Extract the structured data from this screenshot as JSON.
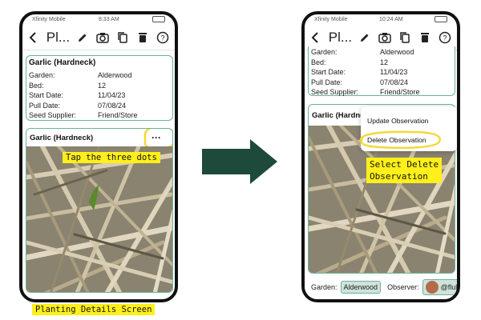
{
  "left_phone": {
    "status": {
      "carrier": "Xfinity Mobile",
      "time": "8:33 AM"
    },
    "nav_title": "Pl...",
    "plant_card": {
      "title": "Garlic (Hardneck)",
      "rows": [
        {
          "label": "Garden:",
          "value": "Alderwood"
        },
        {
          "label": "Bed:",
          "value": "12"
        },
        {
          "label": "Start Date:",
          "value": "11/04/23"
        },
        {
          "label": "Pull Date:",
          "value": "07/08/24"
        },
        {
          "label": "Seed Supplier:",
          "value": "Friend/Store"
        }
      ]
    },
    "observation_card": {
      "title": "Garlic (Hardneck)",
      "more_label": "···"
    },
    "callout": "Tap the three dots"
  },
  "left_caption": "Planting Details Screen",
  "right_phone": {
    "status": {
      "carrier": "Xfinity Mobile",
      "time": "10:24 AM"
    },
    "nav_title": "Pl...",
    "plant_card": {
      "rows": [
        {
          "label": "Garden:",
          "value": "Alderwood"
        },
        {
          "label": "Bed:",
          "value": "12"
        },
        {
          "label": "Start Date:",
          "value": "11/04/23"
        },
        {
          "label": "Pull Date:",
          "value": "07/08/24"
        },
        {
          "label": "Seed Supplier:",
          "value": "Friend/Store"
        }
      ]
    },
    "observation_card": {
      "title": "Garlic (Hardneck)"
    },
    "menu": {
      "update": "Update Observation",
      "delete": "Delete Observation"
    },
    "callout_line1": "Select Delete",
    "callout_line2": "Observation",
    "footer": {
      "garden_label": "Garden:",
      "garden_value": "Alderwood",
      "observer_label": "Observer:",
      "observer_value": "@fluke"
    }
  },
  "colors": {
    "accent": "#6ab29a",
    "highlight": "#ffef1a",
    "arrow": "#1d4a3a"
  },
  "icons": [
    "back-chevron-icon",
    "pencil-icon",
    "camera-icon",
    "copy-icon",
    "trash-icon",
    "help-icon",
    "wifi-icon",
    "more-horizontal-icon",
    "right-arrow-icon"
  ]
}
